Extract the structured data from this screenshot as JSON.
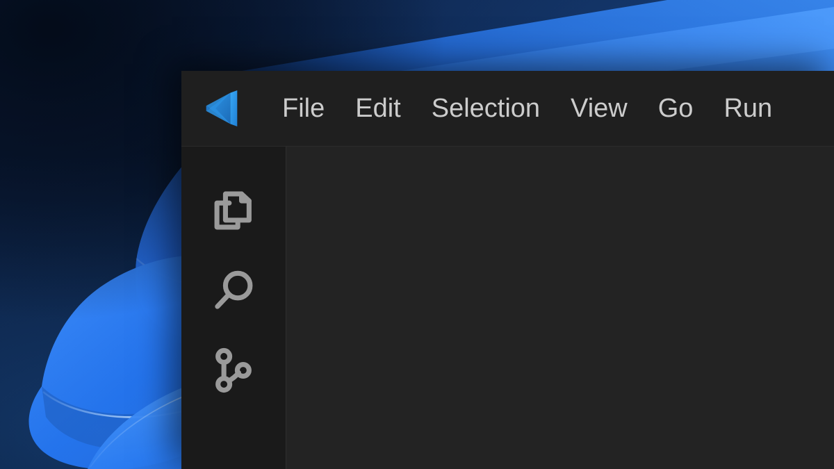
{
  "desktop": {
    "wallpaper_name": "windows-11-bloom-wallpaper",
    "background_color": "#0a1b33",
    "accent_blue": "#1a73e8",
    "ribbon_light": "#4da3ff",
    "ribbon_deep": "#0b4fd6"
  },
  "window": {
    "app_name": "Visual Studio Code",
    "background_color": "#1f1f1f",
    "menubar": {
      "logo_icon": "vscode-logo-icon",
      "logo_color": "#2b9bf4",
      "items": [
        {
          "label": "File",
          "name": "menu-item-file"
        },
        {
          "label": "Edit",
          "name": "menu-item-edit"
        },
        {
          "label": "Selection",
          "name": "menu-item-selection"
        },
        {
          "label": "View",
          "name": "menu-item-view"
        },
        {
          "label": "Go",
          "name": "menu-item-go"
        },
        {
          "label": "Run",
          "name": "menu-item-run"
        }
      ],
      "text_color": "#cccccc",
      "background_color": "#1f1f1f"
    },
    "activity_bar": {
      "background_color": "#1a1a1a",
      "icon_color": "#9a9a9a",
      "items": [
        {
          "label": "Explorer",
          "icon": "files-explorer-icon",
          "name": "activity-bar-item-explorer"
        },
        {
          "label": "Search",
          "icon": "search-magnifier-icon",
          "name": "activity-bar-item-search"
        },
        {
          "label": "Source Control",
          "icon": "source-control-branch-icon",
          "name": "activity-bar-item-source-control"
        }
      ]
    },
    "editor": {
      "background_color": "#232323",
      "content": ""
    }
  }
}
